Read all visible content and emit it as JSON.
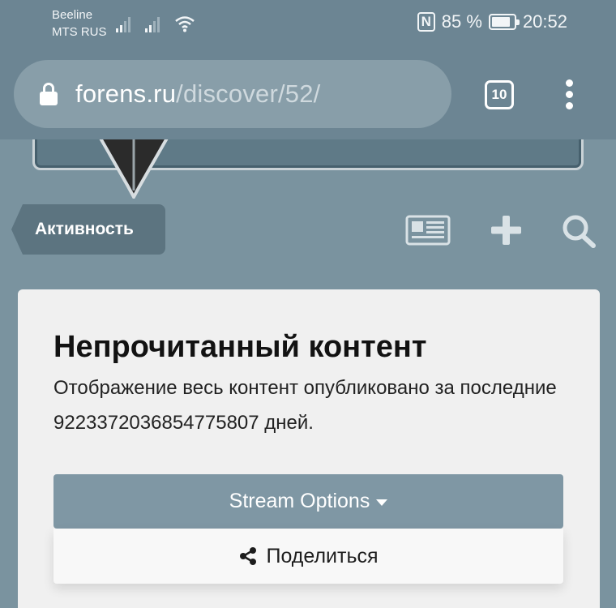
{
  "status_bar": {
    "carrier1": "Beeline",
    "carrier2": "MTS RUS",
    "nfc": "N",
    "battery": "85 %",
    "battery_level": 0.85,
    "time": "20:52"
  },
  "browser": {
    "url_host": "forens.ru",
    "url_path": "/discover/52/",
    "tab_count": "10"
  },
  "nav": {
    "activity_label": "Активность"
  },
  "card": {
    "title": "Непрочитанный контент",
    "description": "Отображение весь контент опубликовано за последние 9223372036854775807 дней.",
    "stream_options_label": "Stream Options",
    "share_label": "Поделиться"
  },
  "colors": {
    "page_bg": "#7a939f",
    "chrome_bg": "#6c8593",
    "button_bg": "#7f97a4",
    "card_bg": "#f0f0f0"
  }
}
